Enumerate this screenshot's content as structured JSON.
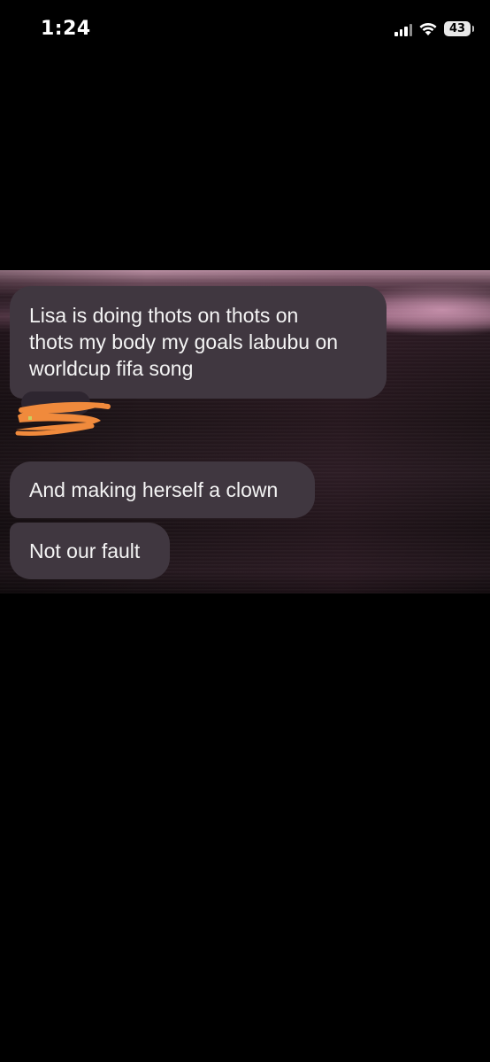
{
  "status_bar": {
    "time": "1:24",
    "battery_level": "43",
    "icons": [
      "signal-icon",
      "wifi-icon",
      "battery-icon"
    ]
  },
  "chat": {
    "messages": [
      {
        "text": "Lisa is doing thots on thots on\nthots my body my goals labubu on\nworldcup fifa song"
      },
      {
        "text": "And making herself a clown"
      },
      {
        "text": "Not our fault"
      }
    ],
    "bubble_color": "#403740",
    "redaction_color": "#f08a3c"
  }
}
